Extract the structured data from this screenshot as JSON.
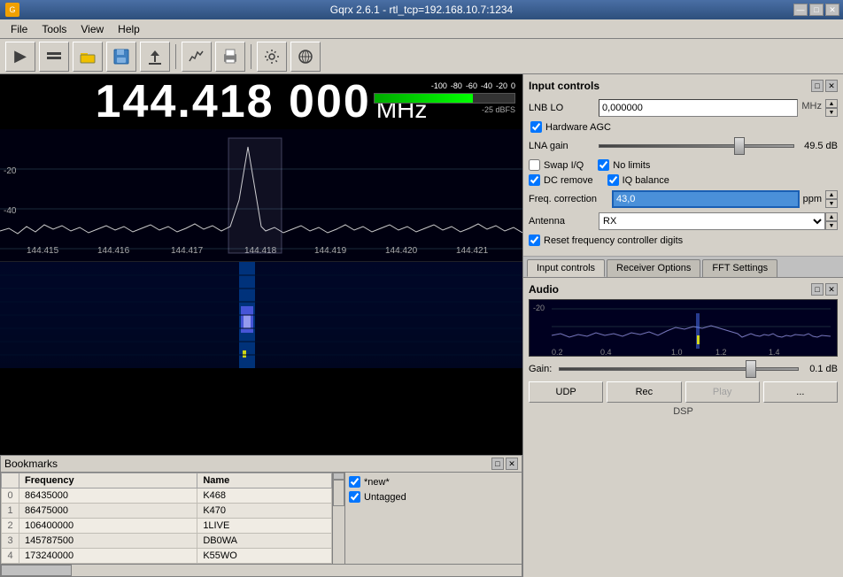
{
  "titlebar": {
    "title": "Gqrx 2.6.1 - rtl_tcp=192.168.10.7:1234",
    "minimize": "—",
    "maximize": "□",
    "close": "✕"
  },
  "menubar": {
    "items": [
      "File",
      "Tools",
      "View",
      "Help"
    ]
  },
  "toolbar": {
    "play_icon": "▶",
    "buttons": [
      "■■",
      "📁",
      "💾",
      "⬆",
      "📊",
      "🖨",
      "⚙",
      "→"
    ]
  },
  "frequency": {
    "display": "144.418 000",
    "unit": "MHz"
  },
  "signal": {
    "scale": "-100  -80  -60  -40  -20  0",
    "dbfs": "-25 dBFS"
  },
  "spectrum": {
    "freq_labels": [
      "144.415",
      "144.416",
      "144.417",
      "144.418",
      "144.419",
      "144.420",
      "144.421"
    ],
    "db_labels": [
      "-20",
      "-40"
    ]
  },
  "input_controls": {
    "title": "Input controls",
    "lnb_lo_label": "LNB LO",
    "lnb_lo_value": "0,000000",
    "lnb_lo_unit": "MHz",
    "hardware_agc_label": "Hardware AGC",
    "hardware_agc_checked": true,
    "lna_gain_label": "LNA gain",
    "lna_gain_value": "49.5 dB",
    "lna_gain_percent": 72,
    "swap_iq_label": "Swap I/Q",
    "swap_iq_checked": false,
    "no_limits_label": "No limits",
    "no_limits_checked": true,
    "dc_remove_label": "DC remove",
    "dc_remove_checked": true,
    "iq_balance_label": "IQ balance",
    "iq_balance_checked": true,
    "freq_correction_label": "Freq. correction",
    "freq_correction_value": "43,0",
    "freq_correction_unit": "ppm",
    "antenna_label": "Antenna",
    "antenna_value": "RX",
    "reset_freq_label": "Reset frequency controller digits",
    "reset_freq_checked": true
  },
  "tabs": {
    "items": [
      "Input controls",
      "Receiver Options",
      "FFT Settings"
    ],
    "active": 0
  },
  "audio": {
    "title": "Audio",
    "gain_label": "Gain:",
    "gain_value": "0.1 dB",
    "gain_percent": 80,
    "btn_udp": "UDP",
    "btn_rec": "Rec",
    "btn_play": "Play",
    "btn_dots": "...",
    "dsp_label": "DSP"
  },
  "bookmarks": {
    "title": "Bookmarks",
    "columns": [
      "",
      "Frequency",
      "Name"
    ],
    "rows": [
      {
        "index": "0",
        "frequency": "86435000",
        "name": "K468"
      },
      {
        "index": "1",
        "frequency": "86475000",
        "name": "K470"
      },
      {
        "index": "2",
        "frequency": "106400000",
        "name": "1LIVE"
      },
      {
        "index": "3",
        "frequency": "145787500",
        "name": "DB0WA"
      },
      {
        "index": "4",
        "frequency": "173240000",
        "name": "K55WO"
      }
    ],
    "tags": [
      "*new*",
      "Untagged"
    ]
  }
}
